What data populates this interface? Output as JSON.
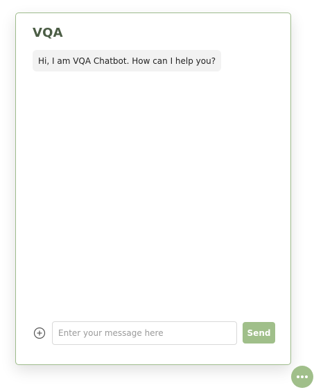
{
  "chat": {
    "title": "VQA",
    "messages": [
      {
        "sender": "bot",
        "text": "Hi, I am VQA Chatbot. How can I help you?"
      }
    ],
    "composer": {
      "attach_icon": "plus-circle-icon",
      "input_value": "",
      "input_placeholder": "Enter your message here",
      "send_label": "Send"
    }
  },
  "launcher": {
    "icon": "chat-ellipsis-icon"
  },
  "colors": {
    "accent": "#a0bf8a",
    "border": "#9dbb8b",
    "title": "#4b5d45",
    "bubble_bg": "#f2f2f2"
  }
}
